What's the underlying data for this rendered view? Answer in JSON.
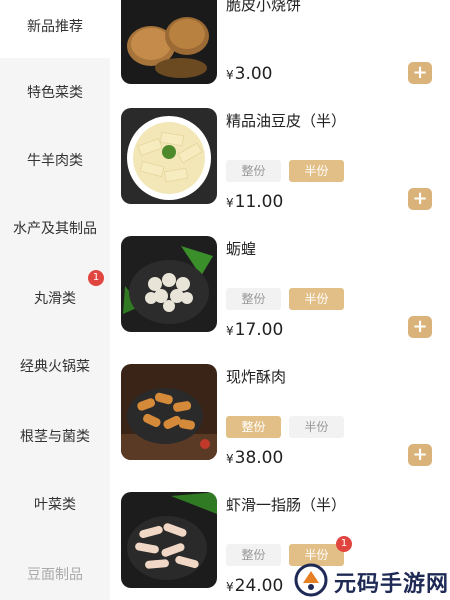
{
  "categories": [
    {
      "label": "新品推荐",
      "active": true
    },
    {
      "label": "特色菜类"
    },
    {
      "label": "牛羊肉类"
    },
    {
      "label": "水产及其制品"
    },
    {
      "label": "丸滑类",
      "badge": "1"
    },
    {
      "label": "经典火锅菜"
    },
    {
      "label": "根茎与菌类"
    },
    {
      "label": "叶菜类"
    },
    {
      "label": "豆面制品"
    }
  ],
  "currency": "¥",
  "items": [
    {
      "name": "脆皮小烧饼",
      "price": "3.00"
    },
    {
      "name": "精品油豆皮（半）",
      "price": "11.00",
      "options": [
        "整份",
        "半份"
      ],
      "selected": "半份"
    },
    {
      "name": "蛎蝗",
      "price": "17.00",
      "options": [
        "整份",
        "半份"
      ],
      "selected": "半份"
    },
    {
      "name": "现炸酥肉",
      "price": "38.00",
      "options": [
        "整份",
        "半份"
      ],
      "selected": "整份"
    },
    {
      "name": "虾滑一指肠（半）",
      "price": "24.00",
      "options": [
        "整份",
        "半份"
      ],
      "selected": "半份",
      "option_badge": "1"
    }
  ],
  "add_symbol": "+",
  "watermark": "元码手游网",
  "colors": {
    "accent": "#d9b37a",
    "chip_selected": "#e2bf86",
    "badge": "#e0463f",
    "sidebar_bg": "#f5f5f5"
  }
}
